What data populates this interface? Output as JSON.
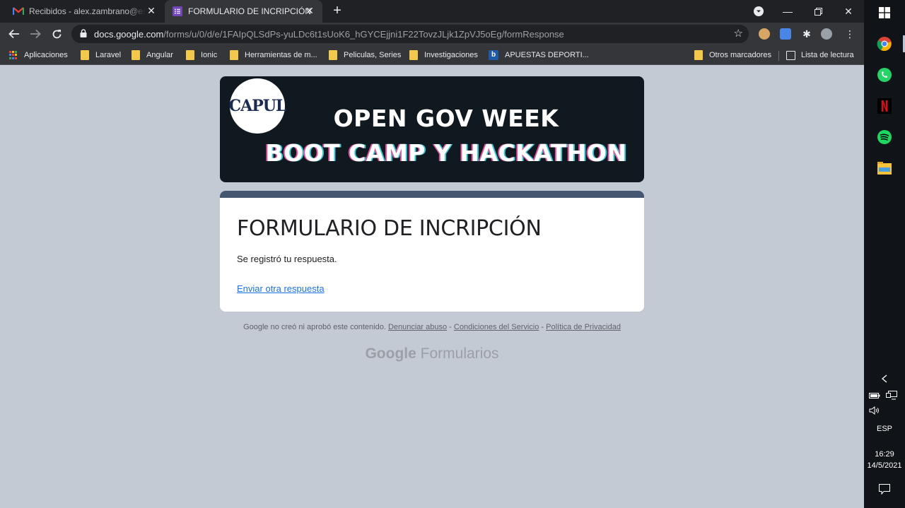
{
  "tabs": [
    {
      "title": "Recibidos - alex.zambrano@espam.edu.ec",
      "icon": "gmail-icon",
      "active": false
    },
    {
      "title": "FORMULARIO DE INCRIPCIÓN",
      "icon": "google-forms-icon",
      "active": true
    }
  ],
  "new_tab_label": "+",
  "address_bar": {
    "host": "docs.google.com",
    "path": "/forms/u/0/d/e/1FAIpQLSdPs-yuLDc6t1sUoK6_hGYCEjjni1F22TovzJLjk1ZpVJ5oEg/formResponse"
  },
  "bookmarks": [
    {
      "label": "Aplicaciones",
      "icon": "apps-grid-icon"
    },
    {
      "label": "Laravel",
      "icon": "folder-icon"
    },
    {
      "label": "Angular",
      "icon": "folder-icon"
    },
    {
      "label": "Ionic",
      "icon": "folder-icon"
    },
    {
      "label": "Herramientas de m...",
      "icon": "folder-icon"
    },
    {
      "label": "Peliculas, Series",
      "icon": "folder-icon"
    },
    {
      "label": "Investigaciones",
      "icon": "folder-icon"
    },
    {
      "label": "APUESTAS DEPORTI...",
      "icon": "bet-icon"
    },
    {
      "label": "Otros marcadores",
      "icon": "folder-icon"
    },
    {
      "label": "Lista de lectura",
      "icon": "reading-list-icon"
    }
  ],
  "banner": {
    "logo_text": "CAPUL",
    "line1": "OPEN GOV WEEK",
    "line2": "BOOT CAMP Y HACKATHON"
  },
  "form": {
    "title": "FORMULARIO DE INCRIPCIÓN",
    "confirmation": "Se registró tu respuesta.",
    "another_response_link": "Enviar otra respuesta"
  },
  "footer": {
    "disclaimer": "Google no creó ni aprobó este contenido.",
    "report_abuse": "Denunciar abuso",
    "terms": "Condiciones del Servicio",
    "privacy": "Política de Privacidad",
    "separator": "-",
    "brand_google": "Google",
    "brand_product": "Formularios"
  },
  "taskbar": {
    "language": "ESP",
    "time": "16:29",
    "date": "14/5/2021"
  },
  "colors": {
    "page_bg": "#c4cad3",
    "form_accent": "#455671",
    "link": "#1a73e8",
    "banner_bg": "#101820"
  }
}
